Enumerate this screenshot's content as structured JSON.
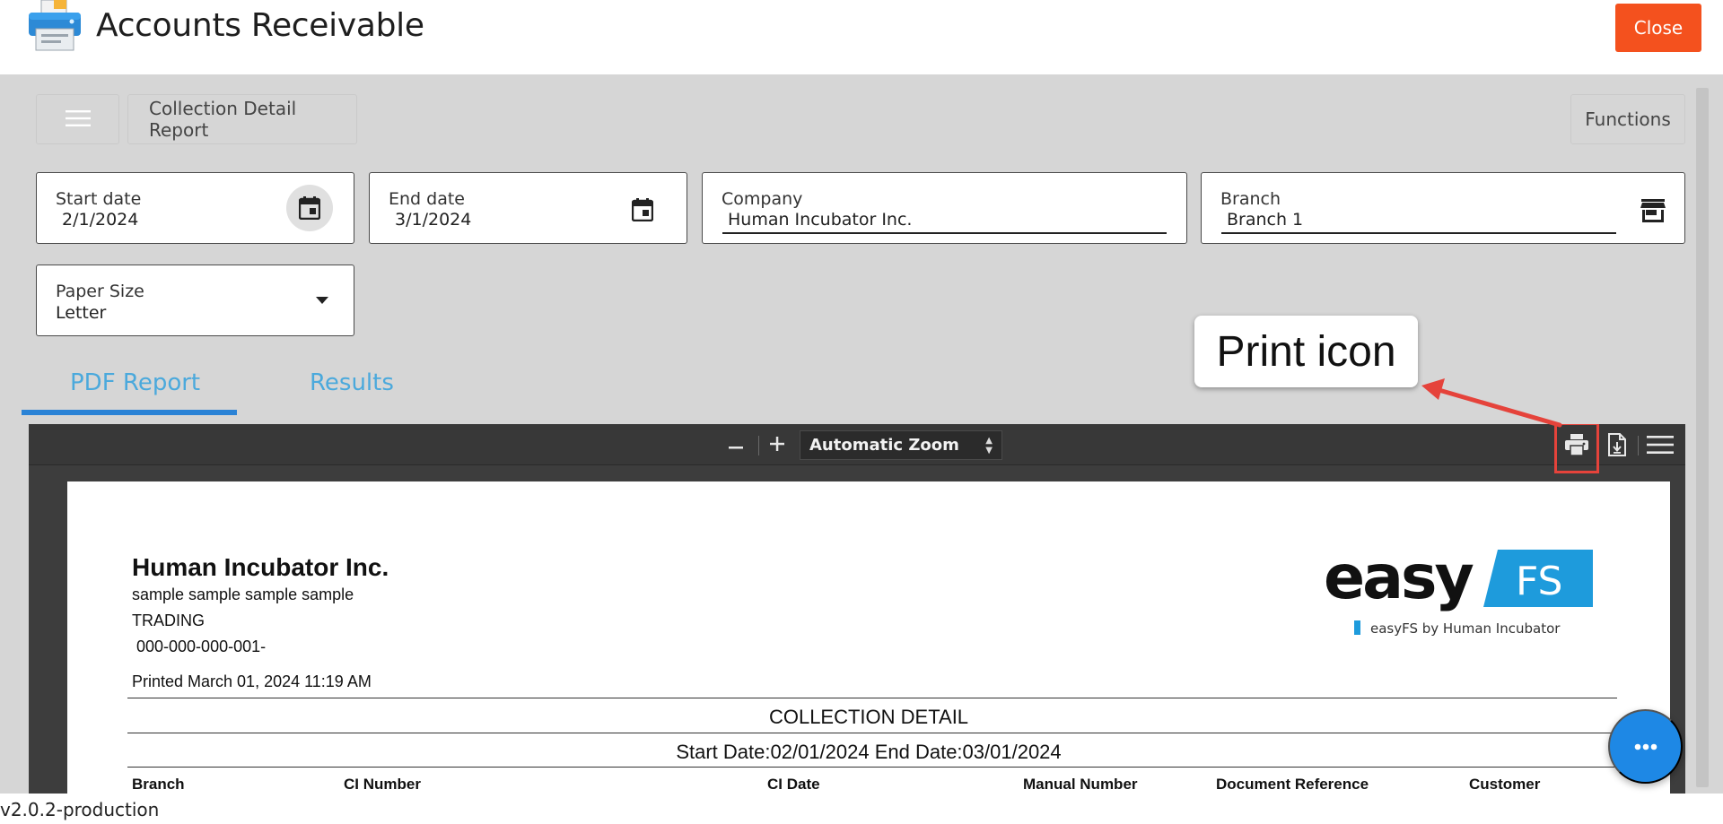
{
  "header": {
    "title": "Accounts Receivable",
    "logo_icon": "printer-logo-icon",
    "close_label": "Close",
    "close_color": "#f4511e"
  },
  "toolbar": {
    "menu_icon": "hamburger-icon",
    "breadcrumb": "Collection Detail Report",
    "functions_label": "Functions"
  },
  "filters": {
    "start_date": {
      "label": "Start date",
      "value": "2/1/2024",
      "icon": "calendar-icon"
    },
    "end_date": {
      "label": "End date",
      "value": "3/1/2024",
      "icon": "calendar-icon"
    },
    "company": {
      "label": "Company",
      "value": "Human Incubator Inc."
    },
    "branch": {
      "label": "Branch",
      "value": "Branch 1",
      "icon": "store-icon"
    },
    "paper_size": {
      "label": "Paper Size",
      "value": "Letter",
      "icon": "dropdown-arrow-icon"
    }
  },
  "tabs": [
    {
      "label": "PDF Report",
      "active": true
    },
    {
      "label": "Results",
      "active": false
    }
  ],
  "pdf_toolbar": {
    "zoom_out": "−",
    "zoom_in": "+",
    "zoom_value": "Automatic Zoom",
    "icons": [
      "print-icon",
      "download-icon",
      "tools-menu-icon"
    ]
  },
  "report": {
    "company_name": "Human Incubator Inc.",
    "address": "sample sample sample sample",
    "business_type": "TRADING",
    "tin": " 000-000-000-001-",
    "printed": "Printed March 01, 2024 11:19 AM",
    "title": "COLLECTION DETAIL",
    "date_range": "Start Date:02/01/2024 End Date:03/01/2024",
    "columns": [
      "Branch",
      "CI Number",
      "CI Date",
      "Manual Number",
      "Document Reference",
      "Customer"
    ],
    "logo_word": "easy",
    "logo_badge": "FS",
    "logo_tagline": "easyFS by Human Incubator",
    "logo_color": "#1e9bdc"
  },
  "annotation": {
    "label": "Print icon",
    "arrow_color": "#e5433b"
  },
  "chat_icon": "chat-dots-icon",
  "footer": {
    "version": "v2.0.2-production"
  }
}
